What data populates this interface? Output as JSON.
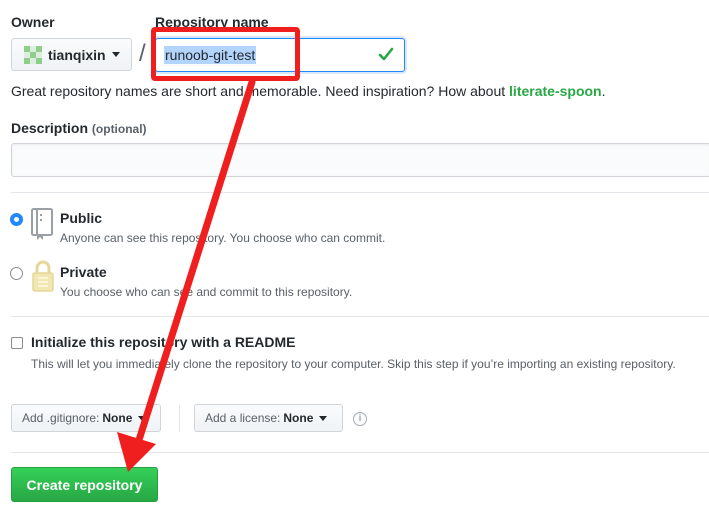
{
  "owner": {
    "label": "Owner",
    "value": "tianqixin"
  },
  "repository": {
    "label": "Repository name",
    "value": "runoob-git-test",
    "separator": "/",
    "hint_prefix": "Great repository names are short and memorable. Need inspiration? How about ",
    "hint_suggestion": "literate-spoon",
    "hint_suffix": "."
  },
  "description": {
    "label": "Description",
    "optional": "(optional)",
    "value": ""
  },
  "visibility": {
    "public": {
      "title": "Public",
      "desc": "Anyone can see this repository. You choose who can commit.",
      "selected": true
    },
    "private": {
      "title": "Private",
      "desc": "You choose who can see and commit to this repository.",
      "selected": false
    }
  },
  "readme": {
    "title": "Initialize this repository with a README",
    "desc": "This will let you immediately clone the repository to your computer. Skip this step if you’re importing an existing repository.",
    "checked": false
  },
  "gitignore": {
    "label": "Add .gitignore:",
    "value": "None"
  },
  "license": {
    "label": "Add a license:",
    "value": "None"
  },
  "info_icon": "i",
  "create_button": "Create repository",
  "colors": {
    "accent": "#2188ff",
    "success": "#28a745",
    "annotation": "#f01f1f"
  }
}
